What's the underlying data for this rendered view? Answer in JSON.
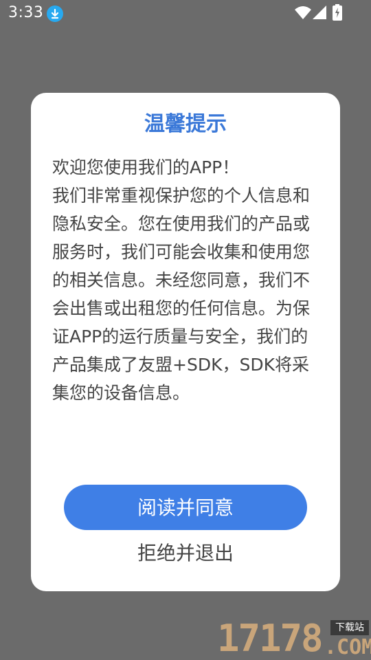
{
  "status_bar": {
    "time": "3:33",
    "icons": [
      "download-icon",
      "wifi-icon",
      "signal-icon",
      "battery-charging-icon"
    ]
  },
  "dialog": {
    "title": "温馨提示",
    "body_line1": "欢迎您使用我们的APP！",
    "body_line2": "我们非常重视保护您的个人信息和隐私安全。您在使用我们的产品或服务时，我们可能会收集和使用您的相关信息。未经您同意，我们不会出售或出租您的任何信息。为保证APP的运行质量与安全，我们的产品集成了友盟+SDK，SDK将采集您的设备信息。",
    "agree_label": "阅读并同意",
    "reject_label": "拒绝并退出"
  },
  "watermark": {
    "number": "17178",
    "tag": "下载站",
    "domain": ".COM"
  },
  "colors": {
    "overlay": "#6b6b6b",
    "accent": "#3f7fe6",
    "title": "#3a78d8",
    "text": "#444444"
  }
}
